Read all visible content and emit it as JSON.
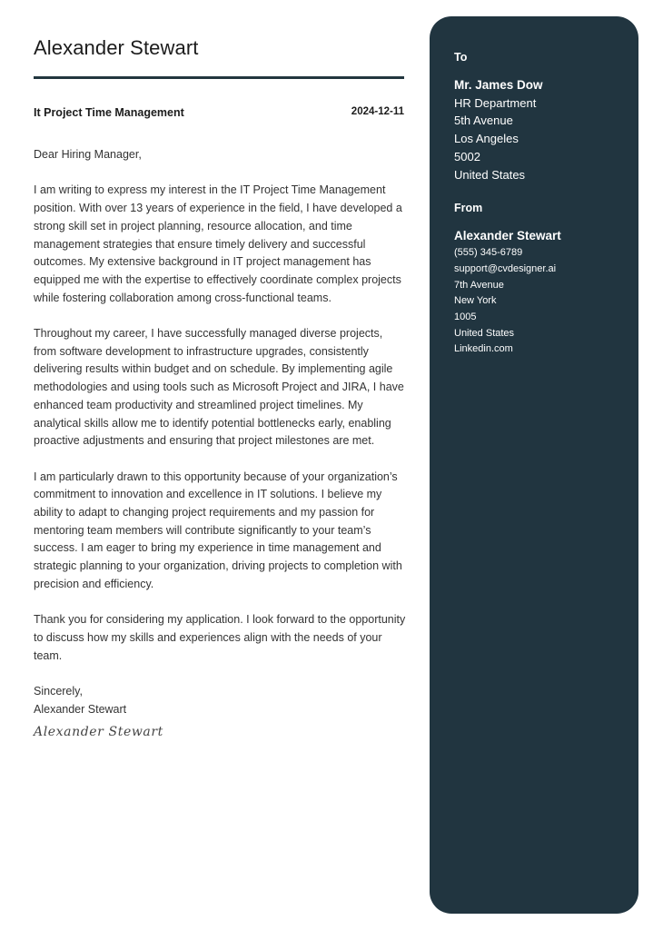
{
  "header": {
    "name": "Alexander Stewart",
    "subject": "It Project Time Management",
    "date": "2024-12-11"
  },
  "letter": {
    "salutation": "Dear Hiring Manager,",
    "paragraphs": [
      "I am writing to express my interest in the IT Project Time Management position. With over 13 years of experience in the field, I have developed a strong skill set in project planning, resource allocation, and time management strategies that ensure timely delivery and successful outcomes. My extensive background in IT project management has equipped me with the expertise to effectively coordinate complex projects while fostering collaboration among cross-functional teams.",
      "Throughout my career, I have successfully managed diverse projects, from software development to infrastructure upgrades, consistently delivering results within budget and on schedule. By implementing agile methodologies and using tools such as Microsoft Project and JIRA, I have enhanced team productivity and streamlined project timelines. My analytical skills allow me to identify potential bottlenecks early, enabling proactive adjustments and ensuring that project milestones are met.",
      "I am particularly drawn to this opportunity because of your organization’s commitment to innovation and excellence in IT solutions. I believe my ability to adapt to changing project requirements and my passion for mentoring team members will contribute significantly to your team’s success. I am eager to bring my experience in time management and strategic planning to your organization, driving projects to completion with precision and efficiency.",
      "Thank you for considering my application. I look forward to the opportunity to discuss how my skills and experiences align with the needs of your team."
    ],
    "closing": "Sincerely,",
    "closing_name": "Alexander Stewart",
    "signature": "Alexander Stewart"
  },
  "sidebar": {
    "to": {
      "heading": "To",
      "name": "Mr. James Dow",
      "lines": [
        "HR Department",
        "5th Avenue",
        "Los Angeles",
        "5002",
        "United States"
      ]
    },
    "from": {
      "heading": "From",
      "name": "Alexander Stewart",
      "lines": [
        "(555) 345-6789",
        "support@cvdesigner.ai",
        "7th Avenue",
        "New York",
        "1005",
        "United States",
        "Linkedin.com"
      ]
    }
  },
  "colors": {
    "sidebar_bg": "#213540",
    "rule": "#22363f",
    "text": "#333333"
  }
}
